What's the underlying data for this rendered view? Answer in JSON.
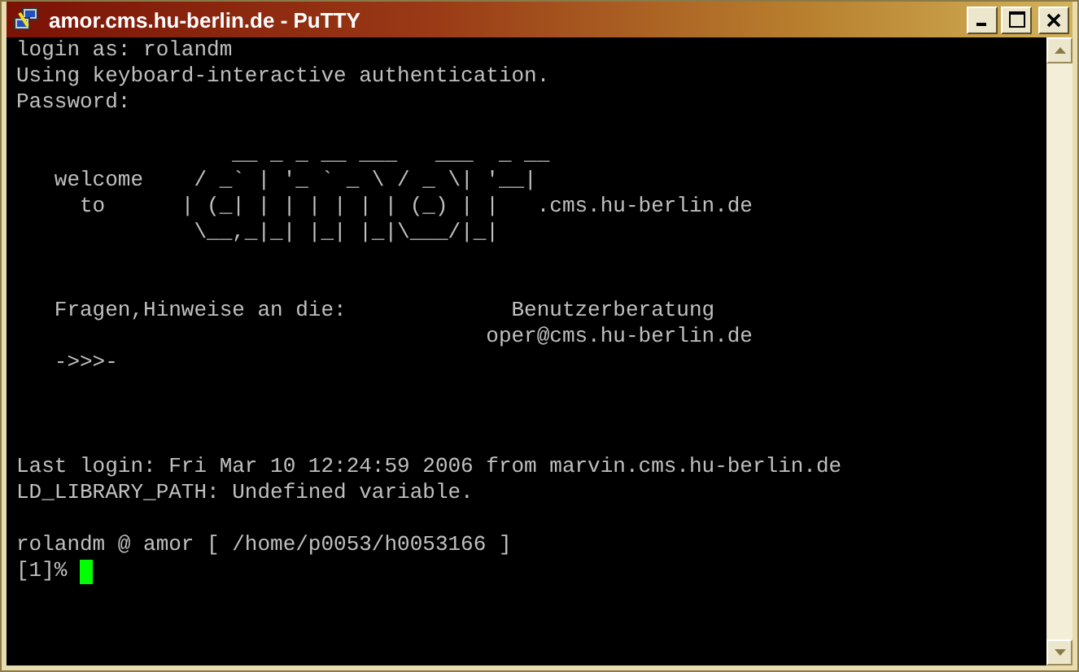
{
  "window": {
    "title": "amor.cms.hu-berlin.de - PuTTY"
  },
  "terminal": {
    "lines": [
      {
        "kind": "text",
        "text": "login as: rolandm"
      },
      {
        "kind": "text",
        "text": "Using keyboard-interactive authentication."
      },
      {
        "kind": "text",
        "text": "Password:"
      },
      {
        "kind": "blank"
      },
      {
        "kind": "text",
        "text": "                 __ _ _ __ ___   ___  _ __"
      },
      {
        "kind": "text",
        "text": "   welcome    / _` | '_ ` _ \\ / _ \\| '__|"
      },
      {
        "kind": "text",
        "text": "     to      | (_| | | | | | | (_) | |   .cms.hu-berlin.de"
      },
      {
        "kind": "text",
        "text": "              \\__,_|_| |_| |_|\\___/|_|"
      },
      {
        "kind": "blank"
      },
      {
        "kind": "blank"
      },
      {
        "kind": "text",
        "text": "   Fragen,Hinweise an die:             Benutzerberatung"
      },
      {
        "kind": "text",
        "text": "                                     oper@cms.hu-berlin.de"
      },
      {
        "kind": "text",
        "text": "   ->>>-"
      },
      {
        "kind": "blank"
      },
      {
        "kind": "blank"
      },
      {
        "kind": "blank"
      },
      {
        "kind": "text",
        "text": "Last login: Fri Mar 10 12:24:59 2006 from marvin.cms.hu-berlin.de"
      },
      {
        "kind": "text",
        "text": "LD_LIBRARY_PATH: Undefined variable."
      },
      {
        "kind": "blank"
      },
      {
        "kind": "text",
        "text": "rolandm @ amor [ /home/p0053/h0053166 ]"
      },
      {
        "kind": "prompt",
        "text": "[1]%",
        "cursor": true
      }
    ]
  }
}
